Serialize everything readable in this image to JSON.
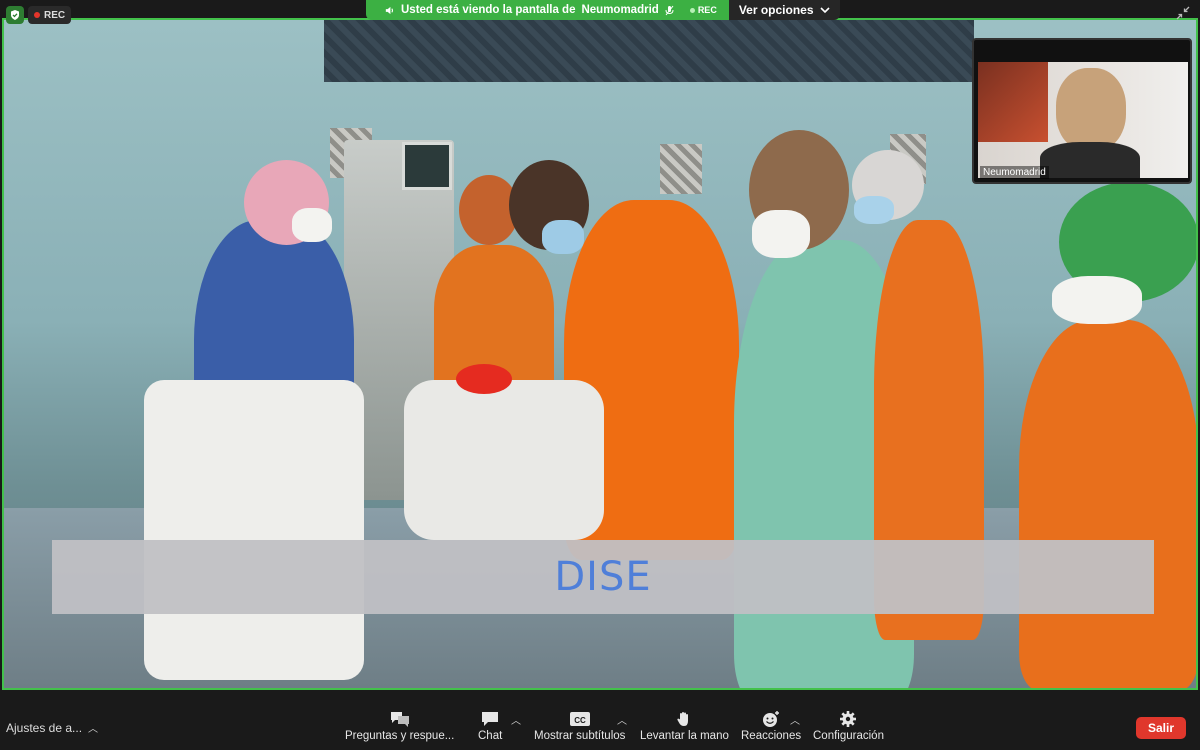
{
  "top_status": {
    "rec_label": "REC"
  },
  "share_banner": {
    "prefix": "Usted está viendo la pantalla de",
    "presenter": "Neumomadrid",
    "rec_label": "REC",
    "view_options": "Ver opciones"
  },
  "shared_content": {
    "caption": "DISE"
  },
  "participant": {
    "name": "Neumomadrid"
  },
  "toolbar": {
    "audio_settings": "Ajustes de a...",
    "items": [
      {
        "label": "Preguntas y respue...",
        "icon": "qa-icon"
      },
      {
        "label": "Chat",
        "icon": "chat-icon"
      },
      {
        "label": "Mostrar subtítulos",
        "icon": "cc-icon"
      },
      {
        "label": "Levantar la mano",
        "icon": "hand-icon"
      },
      {
        "label": "Reacciones",
        "icon": "emoji-icon"
      },
      {
        "label": "Configuración",
        "icon": "gear-icon"
      }
    ],
    "leave_label": "Salir"
  },
  "colors": {
    "share_green": "#3cb043",
    "leave_red": "#e0372c",
    "caption_blue": "#4f7fd9"
  }
}
